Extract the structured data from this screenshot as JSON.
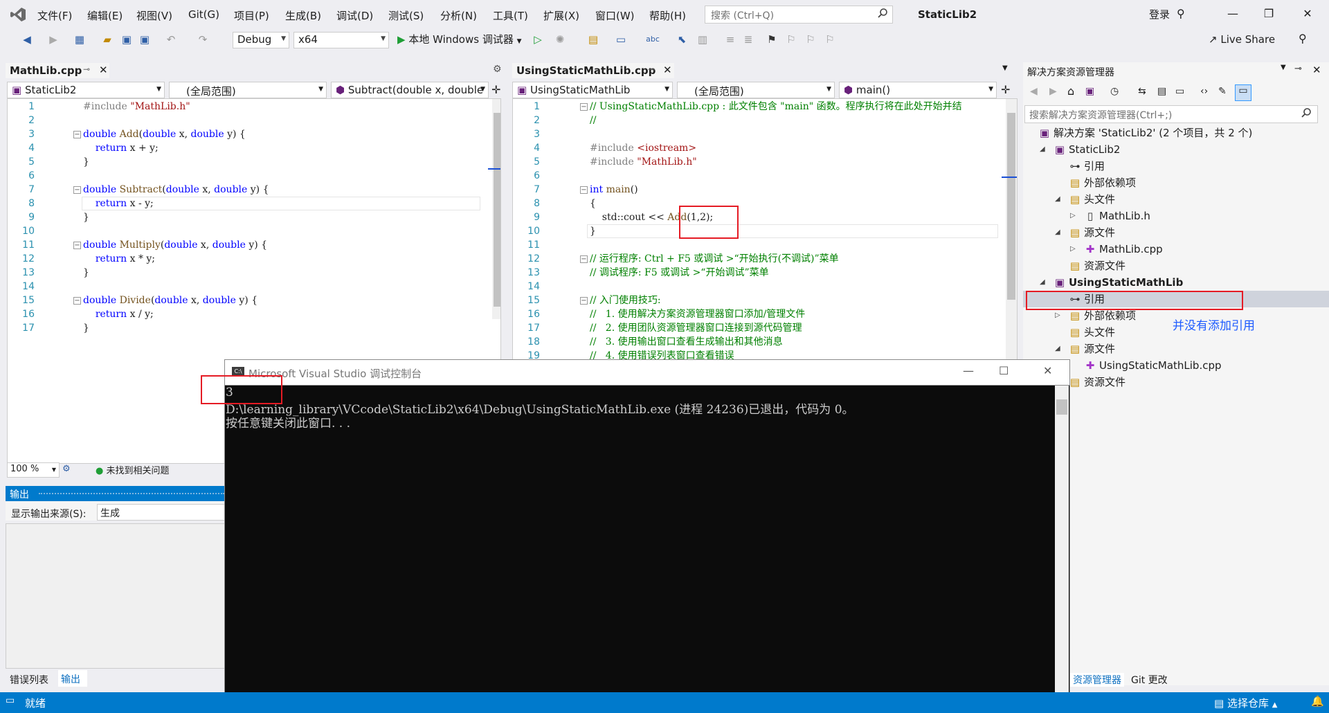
{
  "menubar": {
    "items": [
      "文件(F)",
      "编辑(E)",
      "视图(V)",
      "Git(G)",
      "项目(P)",
      "生成(B)",
      "调试(D)",
      "测试(S)",
      "分析(N)",
      "工具(T)",
      "扩展(X)",
      "窗口(W)",
      "帮助(H)"
    ],
    "search_placeholder": "搜索 (Ctrl+Q)",
    "solution_title": "StaticLib2",
    "login": "登录"
  },
  "toolbar": {
    "config": "Debug",
    "platform": "x64",
    "run_label": "本地 Windows 调试器",
    "live_share": "Live Share"
  },
  "left_editor": {
    "tab": "MathLib.cpp",
    "project_combo": "StaticLib2",
    "scope_combo": "(全局范围)",
    "member_combo": "Subtract(double x, double",
    "lines": [
      {
        "n": "1",
        "text": "#include \"MathLib.h\""
      },
      {
        "n": "2",
        "text": ""
      },
      {
        "n": "3",
        "text": "double Add(double x, double y) {"
      },
      {
        "n": "4",
        "text": "    return x + y;"
      },
      {
        "n": "5",
        "text": "}"
      },
      {
        "n": "6",
        "text": ""
      },
      {
        "n": "7",
        "text": "double Subtract(double x, double y) {"
      },
      {
        "n": "8",
        "text": "    return x - y;"
      },
      {
        "n": "9",
        "text": "}"
      },
      {
        "n": "10",
        "text": ""
      },
      {
        "n": "11",
        "text": "double Multiply(double x, double y) {"
      },
      {
        "n": "12",
        "text": "    return x * y;"
      },
      {
        "n": "13",
        "text": "}"
      },
      {
        "n": "14",
        "text": ""
      },
      {
        "n": "15",
        "text": "double Divide(double x, double y) {"
      },
      {
        "n": "16",
        "text": "    return x / y;"
      },
      {
        "n": "17",
        "text": "}"
      }
    ],
    "zoom": "100 %",
    "issues": "未找到相关问题"
  },
  "right_editor": {
    "tab": "UsingStaticMathLib.cpp",
    "project_combo": "UsingStaticMathLib",
    "scope_combo": "(全局范围)",
    "member_combo": "main()",
    "lines": [
      {
        "n": "1",
        "text": "// UsingStaticMathLib.cpp : 此文件包含 \"main\" 函数。程序执行将在此处开始并结"
      },
      {
        "n": "2",
        "text": "//"
      },
      {
        "n": "3",
        "text": ""
      },
      {
        "n": "4",
        "text": "#include <iostream>"
      },
      {
        "n": "5",
        "text": "#include \"MathLib.h\""
      },
      {
        "n": "6",
        "text": ""
      },
      {
        "n": "7",
        "text": "int main()"
      },
      {
        "n": "8",
        "text": "{"
      },
      {
        "n": "9",
        "text": "    std::cout << Add(1,2);"
      },
      {
        "n": "10",
        "text": "}"
      },
      {
        "n": "11",
        "text": ""
      },
      {
        "n": "12",
        "text": "// 运行程序: Ctrl + F5 或调试 >“开始执行(不调试)”菜单"
      },
      {
        "n": "13",
        "text": "// 调试程序: F5 或调试 >“开始调试”菜单"
      },
      {
        "n": "14",
        "text": ""
      },
      {
        "n": "15",
        "text": "// 入门使用技巧:"
      },
      {
        "n": "16",
        "text": "//   1. 使用解决方案资源管理器窗口添加/管理文件"
      },
      {
        "n": "17",
        "text": "//   2. 使用团队资源管理器窗口连接到源代码管理"
      },
      {
        "n": "18",
        "text": "//   3. 使用输出窗口查看生成输出和其他消息"
      },
      {
        "n": "19",
        "text": "//   4. 使用错误列表窗口查看错误"
      }
    ]
  },
  "output": {
    "title": "输出",
    "source_label": "显示输出来源(S):",
    "source_value": "生成",
    "tab_errors": "错误列表",
    "tab_output": "输出"
  },
  "solution_explorer": {
    "title": "解决方案资源管理器",
    "search_placeholder": "搜索解决方案资源管理器(Ctrl+;)",
    "items": [
      {
        "label": "解决方案 'StaticLib2' (2 个项目，共 2 个)"
      },
      {
        "label": "StaticLib2"
      },
      {
        "label": "引用"
      },
      {
        "label": "外部依赖项"
      },
      {
        "label": "头文件"
      },
      {
        "label": "MathLib.h"
      },
      {
        "label": "源文件"
      },
      {
        "label": "MathLib.cpp"
      },
      {
        "label": "资源文件"
      },
      {
        "label": "UsingStaticMathLib"
      },
      {
        "label": "引用"
      },
      {
        "label": "外部依赖项"
      },
      {
        "label": "头文件"
      },
      {
        "label": "源文件"
      },
      {
        "label": "UsingStaticMathLib.cpp"
      },
      {
        "label": "资源文件"
      }
    ],
    "annotation": "并没有添加引用",
    "bottom_tab": "资源管理器",
    "git_tab": "Git 更改"
  },
  "console": {
    "title": "Microsoft Visual Studio 调试控制台",
    "lines": [
      "3",
      "D:\\learning_library\\VCcode\\StaticLib2\\x64\\Debug\\UsingStaticMathLib.exe (进程 24236)已退出，代码为 0。",
      "按任意键关闭此窗口. . ."
    ]
  },
  "statusbar": {
    "ready": "就绪",
    "repo": "选择仓库"
  },
  "colors": {
    "accent": "#007acc",
    "annotation": "#e51b24",
    "annotation_text": "#1e5cff"
  }
}
